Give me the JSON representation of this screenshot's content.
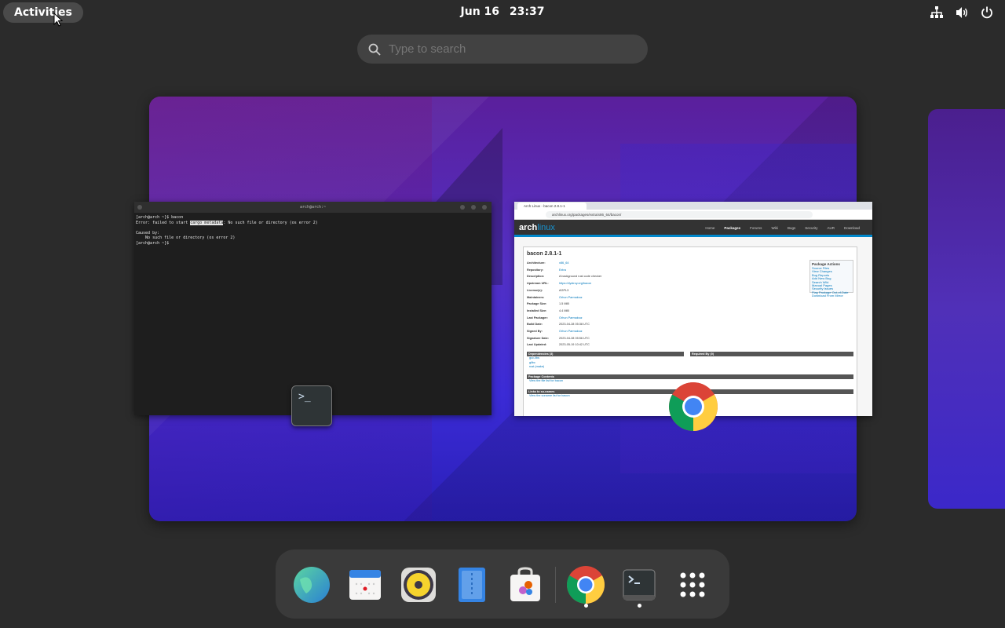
{
  "topbar": {
    "activities_label": "Activities",
    "date": "Jun 16",
    "time": "23:37",
    "tray_icons": [
      "network-icon",
      "volume-icon",
      "power-icon"
    ]
  },
  "search": {
    "placeholder": "Type to search"
  },
  "terminal_window": {
    "title": "arch@arch:~",
    "lines": [
      "[arch@arch ~]$ bacon",
      "Error: failed to start ",
      "Caused by:",
      "    No such file or directory (os error 2)",
      "[arch@arch ~]$ "
    ],
    "highlight_text": "cargo metadata",
    "error_suffix": ": No such file or directory (os error 2)"
  },
  "browser_window": {
    "tab_title": "Arch Linux - bacon 2.8.1-1",
    "url": "archlinux.org/packages/extra/x86_64/bacon/",
    "logo_main": "arch",
    "logo_sub": "linux",
    "nav": [
      "Home",
      "Packages",
      "Forums",
      "Wiki",
      "Bugs",
      "Security",
      "AUR",
      "Download"
    ],
    "nav_active": "Packages",
    "package_title": "bacon 2.8.1-1",
    "details": [
      {
        "k": "Architecture:",
        "v": "x86_64",
        "link": true
      },
      {
        "k": "Repository:",
        "v": "Extra",
        "link": true
      },
      {
        "k": "Description:",
        "v": "A background rust code checker",
        "link": false
      },
      {
        "k": "Upstream URL:",
        "v": "https://dystroy.org/bacon",
        "link": true
      },
      {
        "k": "License(s):",
        "v": "AGPL3",
        "link": false
      },
      {
        "k": "Maintainers:",
        "v": "Orhun Parmaksız",
        "link": true
      },
      {
        "k": "Package Size:",
        "v": "1.5 MiB",
        "link": false
      },
      {
        "k": "Installed Size:",
        "v": "4.4 MiB",
        "link": false
      },
      {
        "k": "Last Packager:",
        "v": "Orhun Parmaksız",
        "link": true
      },
      {
        "k": "Build Date:",
        "v": "2023-04-28 05:38 UTC",
        "link": false
      },
      {
        "k": "Signed By:",
        "v": "Orhun Parmaksız",
        "link": true
      },
      {
        "k": "Signature Date:",
        "v": "2023-04-28 05:56 UTC",
        "link": false
      },
      {
        "k": "Last Updated:",
        "v": "2023-05-19 10:42 UTC",
        "link": false
      }
    ],
    "actions_title": "Package Actions",
    "actions": [
      "Source Files",
      "View Changes",
      "Bug Reports",
      "Add New Bug",
      "Search Wiki",
      "Manual Pages",
      "Security Issues",
      "Flag Package Out-of-Date",
      "Download From Mirror"
    ],
    "deps_title": "Dependencies (3)",
    "deps": [
      "gcc-libs",
      "glibc",
      "rust (make)"
    ],
    "required_by_title": "Required By (0)",
    "contents_title": "Package Contents",
    "contents_link": "View the file list for bacon",
    "links_title": "Links to so-names",
    "links_link": "View the soname list for bacon"
  },
  "dash": {
    "apps": [
      "browser-icon",
      "calendar-icon",
      "music-player-icon",
      "text-editor-icon",
      "software-store-icon",
      "chrome-icon",
      "terminal-icon",
      "show-apps-icon"
    ],
    "running": [
      "chrome-icon",
      "terminal-icon"
    ]
  },
  "colors": {
    "accent": "#1793d1",
    "panel": "#3a3a3a",
    "wallpaper_purple": "#5b20a5",
    "wallpaper_blue": "#3a29d4"
  }
}
